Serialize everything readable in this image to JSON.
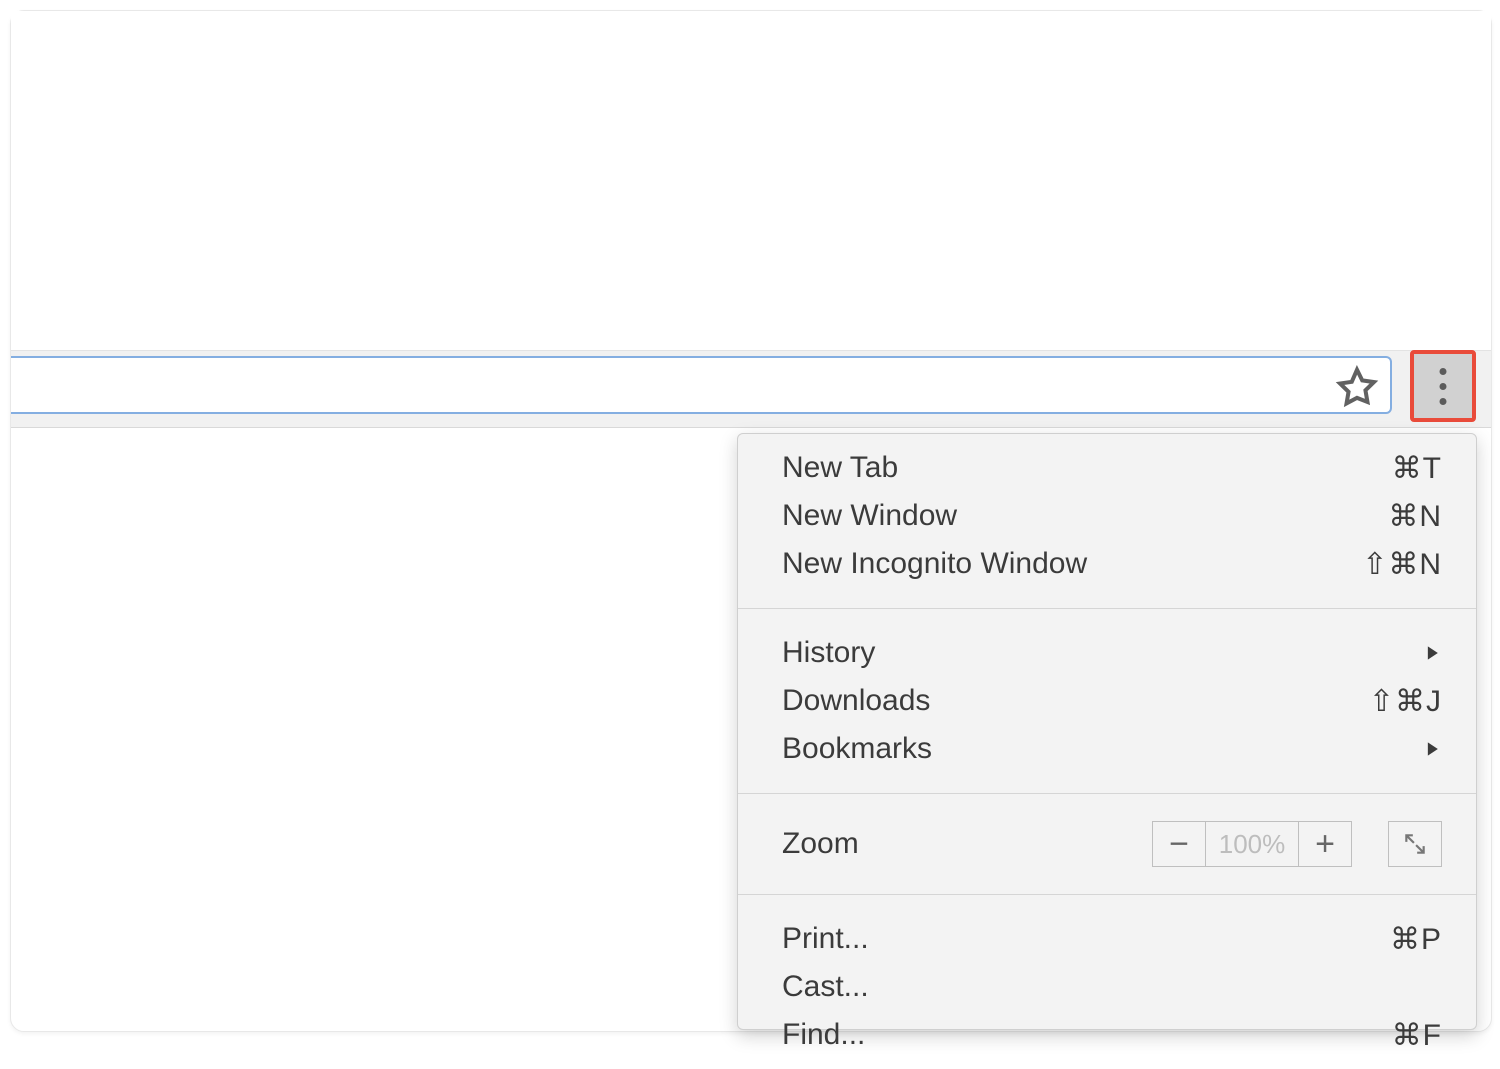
{
  "icons": {
    "star": "star-icon",
    "kebab": "kebab-icon",
    "submenu_arrow": "chevron-right-icon",
    "fullscreen": "fullscreen-icon",
    "minus": "minus-icon",
    "plus": "plus-icon"
  },
  "omnibox": {
    "value": "",
    "placeholder": ""
  },
  "menu": {
    "items": [
      {
        "label": "New Tab",
        "shortcut": "⌘T"
      },
      {
        "label": "New Window",
        "shortcut": "⌘N"
      },
      {
        "label": "New Incognito Window",
        "shortcut": "⇧⌘N"
      }
    ],
    "items2": [
      {
        "label": "History",
        "submenu": true
      },
      {
        "label": "Downloads",
        "shortcut": "⇧⌘J"
      },
      {
        "label": "Bookmarks",
        "submenu": true
      }
    ],
    "zoom": {
      "label": "Zoom",
      "value": "100%",
      "minus": "−",
      "plus": "+"
    },
    "items3": [
      {
        "label": "Print...",
        "shortcut": "⌘P"
      },
      {
        "label": "Cast..."
      },
      {
        "label": "Find...",
        "shortcut": "⌘F"
      }
    ]
  },
  "highlight": {
    "color": "#e94b3a"
  }
}
